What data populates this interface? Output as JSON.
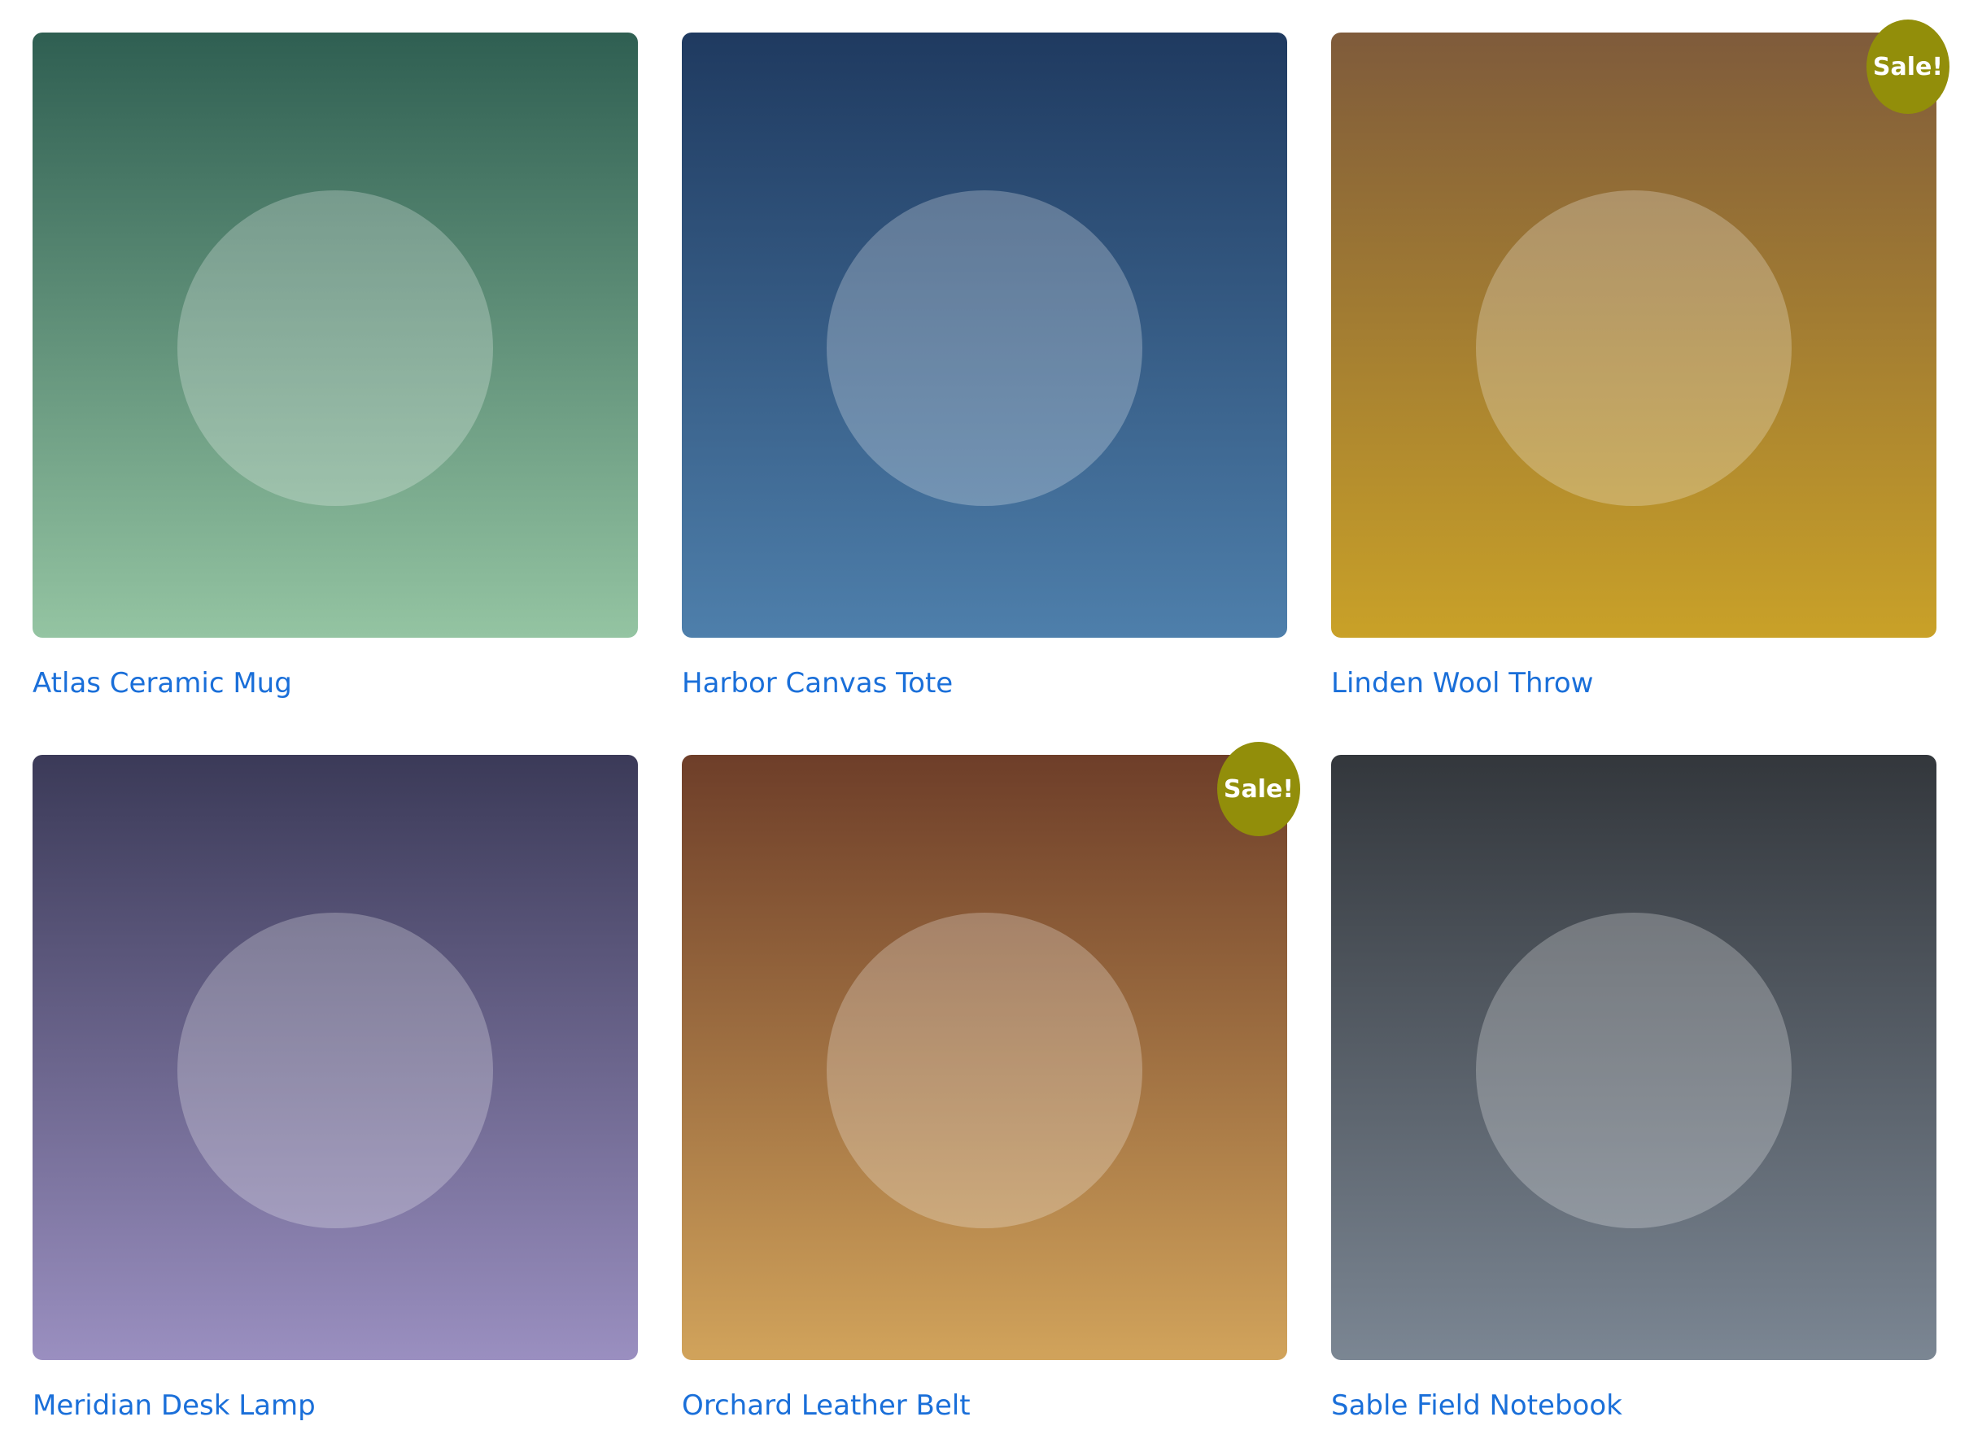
{
  "sale_badge": {
    "label": "Sale!",
    "color": "#928e0a"
  },
  "title_color": "#1a6fd9",
  "products": [
    {
      "title": "Atlas Ceramic Mug",
      "on_sale": false,
      "gradient": [
        "#2f5f52",
        "#94c4a2"
      ]
    },
    {
      "title": "Harbor Canvas Tote",
      "on_sale": false,
      "gradient": [
        "#1f3a60",
        "#4e7fab"
      ]
    },
    {
      "title": "Linden Wool Throw",
      "on_sale": true,
      "gradient": [
        "#7f5b3b",
        "#c9a128"
      ]
    },
    {
      "title": "Meridian Desk Lamp",
      "on_sale": false,
      "gradient": [
        "#3b3a58",
        "#9a8fc0"
      ]
    },
    {
      "title": "Orchard Leather Belt",
      "on_sale": true,
      "gradient": [
        "#6e3e29",
        "#d1a35b"
      ]
    },
    {
      "title": "Sable Field Notebook",
      "on_sale": false,
      "gradient": [
        "#33373c",
        "#7b8693"
      ]
    }
  ]
}
